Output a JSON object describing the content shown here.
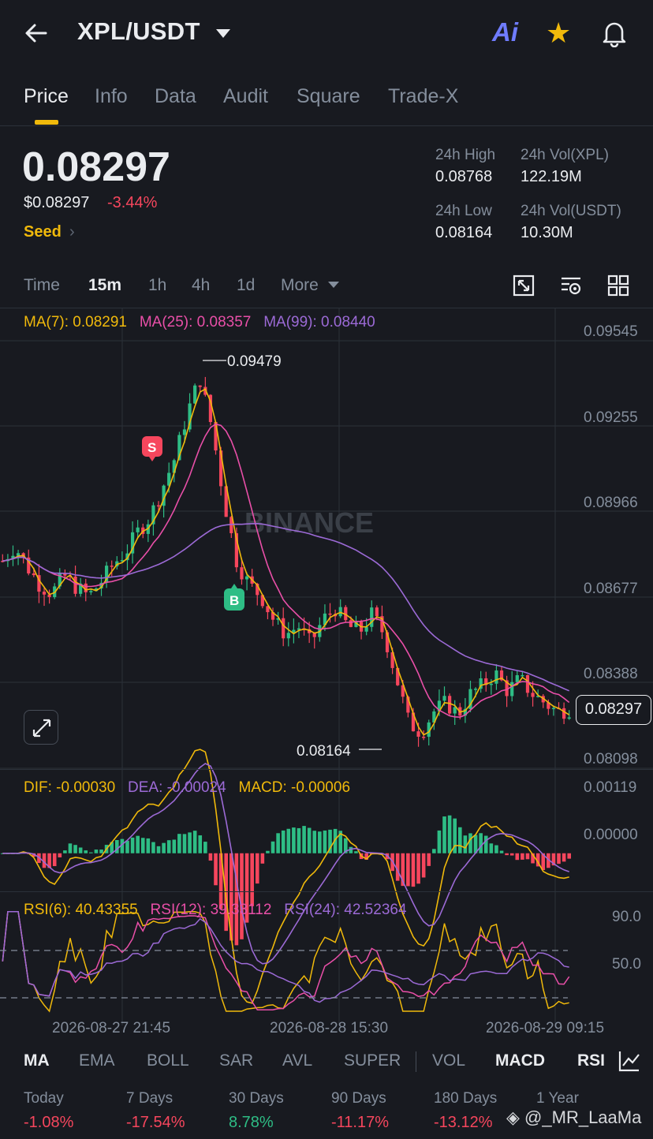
{
  "header": {
    "pair": "XPL/USDT",
    "ai_label": "Ai"
  },
  "tabs": [
    "Price",
    "Info",
    "Data",
    "Audit",
    "Square",
    "Trade-X"
  ],
  "ticker": {
    "last_price": "0.08297",
    "usd_price": "$0.08297",
    "change": "-3.44%",
    "tag": "Seed",
    "high_label": "24h High",
    "high_value": "0.08768",
    "vol_base_label": "24h Vol(XPL)",
    "vol_base_value": "122.19M",
    "low_label": "24h Low",
    "low_value": "0.08164",
    "vol_quote_label": "24h Vol(USDT)",
    "vol_quote_value": "10.30M"
  },
  "intervals": [
    "Time",
    "15m",
    "1h",
    "4h",
    "1d",
    "More"
  ],
  "ma_legend": {
    "ma7": "MA(7): 0.08291",
    "ma25": "MA(25): 0.08357",
    "ma99": "MA(99): 0.08440"
  },
  "price_axis": [
    "0.09545",
    "0.09255",
    "0.08966",
    "0.08677",
    "0.08388",
    "0.08098"
  ],
  "chart_labels": {
    "high_marker": "0.09479",
    "low_marker": "0.08164",
    "current": "0.08297",
    "sell": "S",
    "buy": "B",
    "watermark": "BINANCE"
  },
  "macd_legend": {
    "dif": "DIF: -0.00030",
    "dea": "DEA: -0.00024",
    "macd": "MACD: -0.00006"
  },
  "macd_axis": [
    "0.00119",
    "0.00000"
  ],
  "rsi_legend": {
    "rsi6": "RSI(6): 40.43355",
    "rsi12": "RSI(12): 39.33112",
    "rsi24": "RSI(24): 42.52364"
  },
  "rsi_axis": [
    "90.0",
    "50.0"
  ],
  "time_axis": [
    "2026-08-27 21:45",
    "2026-08-28 15:30",
    "2026-08-29 09:15"
  ],
  "indicators": [
    "MA",
    "EMA",
    "BOLL",
    "SAR",
    "AVL",
    "SUPER",
    "VOL",
    "MACD",
    "RSI"
  ],
  "performance": [
    {
      "label": "Today",
      "value": "-1.08%"
    },
    {
      "label": "7 Days",
      "value": "-17.54%"
    },
    {
      "label": "30 Days",
      "value": "8.78%"
    },
    {
      "label": "90 Days",
      "value": "-11.17%"
    },
    {
      "label": "180 Days",
      "value": "-13.12%"
    },
    {
      "label": "1 Year",
      "value": ""
    }
  ],
  "watermark_user": "@_MR_LaaMa",
  "colors": {
    "up": "#2ebd85",
    "down": "#f6465d",
    "accent": "#f0b90b",
    "ma7": "#f0b90b",
    "ma25": "#e94fa8",
    "ma99": "#9c6ad6"
  },
  "icons": [
    "back-arrow-icon",
    "ai-icon",
    "star-icon",
    "bell-icon",
    "fullscreen-icon",
    "chart-settings-icon",
    "layout-grid-icon",
    "expand-icon",
    "drawing-tool-icon",
    "chevron-right-icon"
  ],
  "chart_data": {
    "type": "candlestick",
    "interval": "15m",
    "price_range": [
      0.08098,
      0.09545
    ],
    "series": [
      {
        "name": "MA(7)",
        "last": 0.08291
      },
      {
        "name": "MA(25)",
        "last": 0.08357
      },
      {
        "name": "MA(99)",
        "last": 0.0844
      }
    ],
    "marked_high": 0.09479,
    "marked_low": 0.08164,
    "last_price": 0.08297,
    "close_approx": [
      0.088,
      0.0885,
      0.0878,
      0.0872,
      0.0869,
      0.0875,
      0.0871,
      0.0868,
      0.0873,
      0.0879,
      0.0883,
      0.089,
      0.0895,
      0.0905,
      0.0915,
      0.093,
      0.0942,
      0.0925,
      0.09,
      0.088,
      0.0872,
      0.0868,
      0.086,
      0.0855,
      0.0858,
      0.0852,
      0.086,
      0.0864,
      0.0858,
      0.0856,
      0.0862,
      0.0855,
      0.084,
      0.0825,
      0.0822,
      0.0829,
      0.0832,
      0.0828,
      0.0835,
      0.0838,
      0.0842,
      0.0836,
      0.084,
      0.0835,
      0.0832,
      0.0829,
      0.083
    ],
    "macd_range": [
      -0.0008,
      0.00119
    ],
    "rsi_levels": [
      90.0,
      50.0
    ]
  }
}
